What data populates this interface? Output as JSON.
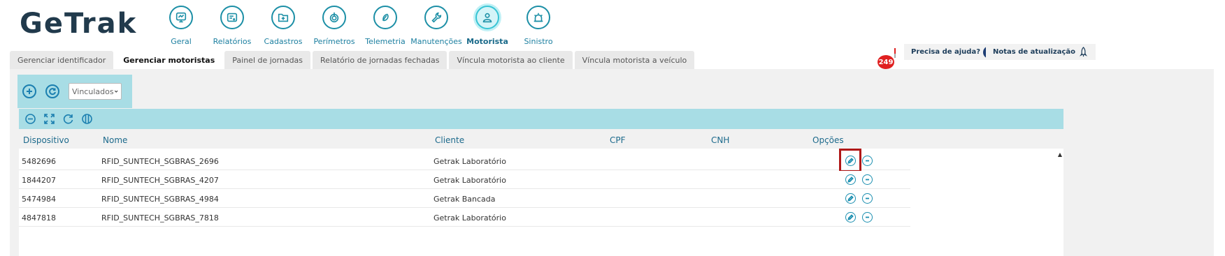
{
  "app": {
    "logo_text": "GeTrak"
  },
  "modules": [
    {
      "label": "Geral",
      "icon": "monitor-icon"
    },
    {
      "label": "Relatórios",
      "icon": "report-icon"
    },
    {
      "label": "Cadastros",
      "icon": "folder-add-icon"
    },
    {
      "label": "Perímetros",
      "icon": "target-icon"
    },
    {
      "label": "Telemetria",
      "icon": "speed-icon"
    },
    {
      "label": "Manutenções",
      "icon": "wrench-icon"
    },
    {
      "label": "Motorista",
      "icon": "driver-icon",
      "active": true
    },
    {
      "label": "Sinistro",
      "icon": "alarm-icon"
    }
  ],
  "tabs": [
    {
      "label": "Gerenciar identificador"
    },
    {
      "label": "Gerenciar motoristas",
      "active": true
    },
    {
      "label": "Painel de jornadas"
    },
    {
      "label": "Relatório de jornadas fechadas"
    },
    {
      "label": "Víncula motorista ao cliente"
    },
    {
      "label": "Víncula motorista a veículo"
    }
  ],
  "header_right": {
    "notifications_count": "249",
    "help_label": "Precisa de ajuda?",
    "updates_label": "Notas de atualização"
  },
  "toolbar": {
    "filter_value": "Vinculados"
  },
  "table": {
    "columns": [
      "Dispositivo",
      "Nome",
      "Cliente",
      "CPF",
      "CNH",
      "Opções"
    ],
    "rows": [
      {
        "dispositivo": "5482696",
        "nome": "RFID_SUNTECH_SGBRAS_2696",
        "cliente": "Getrak Laboratório",
        "cpf": "",
        "cnh": ""
      },
      {
        "dispositivo": "1844207",
        "nome": "RFID_SUNTECH_SGBRAS_4207",
        "cliente": "Getrak Laboratório",
        "cpf": "",
        "cnh": ""
      },
      {
        "dispositivo": "5474984",
        "nome": "RFID_SUNTECH_SGBRAS_4984",
        "cliente": "Getrak Bancada",
        "cpf": "",
        "cnh": ""
      },
      {
        "dispositivo": "4847818",
        "nome": "RFID_SUNTECH_SGBRAS_7818",
        "cliente": "Getrak Laboratório",
        "cpf": "",
        "cnh": ""
      }
    ]
  },
  "colors": {
    "accent": "#1b8fb0",
    "toolbar_bg": "#a8dde5",
    "highlight": "#b01818",
    "badge": "#e02020"
  }
}
